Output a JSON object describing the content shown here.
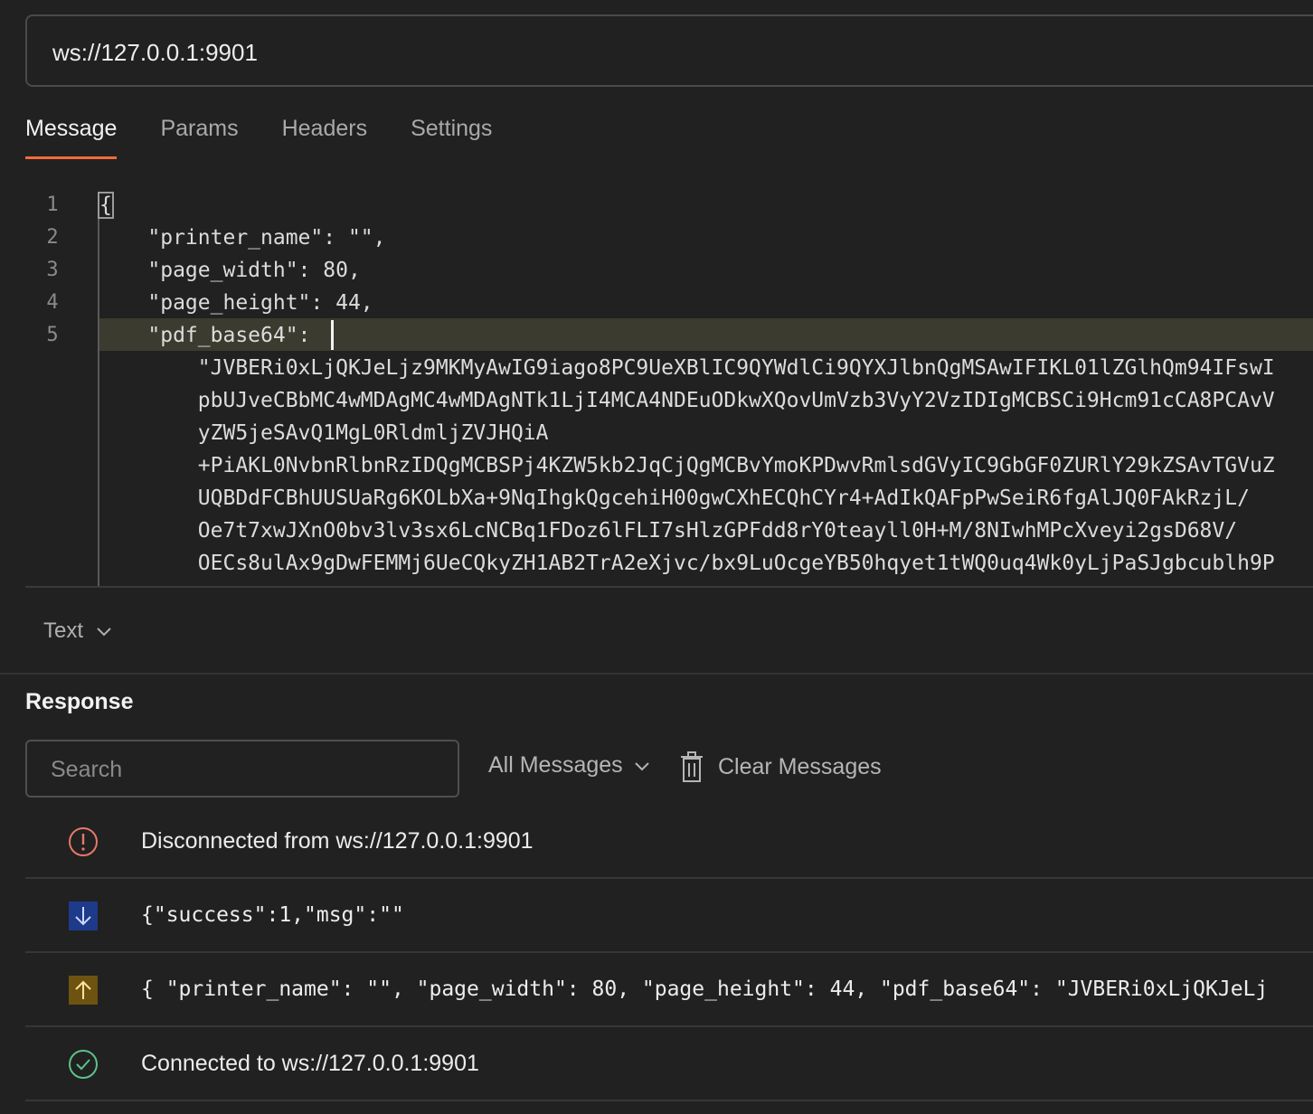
{
  "url": {
    "value": "ws://127.0.0.1:9901"
  },
  "tabs": [
    {
      "label": "Message",
      "active": true
    },
    {
      "label": "Params",
      "active": false
    },
    {
      "label": "Headers",
      "active": false
    },
    {
      "label": "Settings",
      "active": false
    }
  ],
  "editor": {
    "line_numbers": [
      "1",
      "2",
      "3",
      "4",
      "5"
    ],
    "lines": [
      "{",
      "    \"printer_name\": \"\",",
      "    \"page_width\": 80,",
      "    \"page_height\": 44,",
      "    \"pdf_base64\": ",
      "        \"JVBERi0xLjQKJeLjz9MKMyAwIG9iago8PC9UeXBlIC9QYWdlCi9QYXJlbnQgMSAwIFIKL01lZGlhQm94IFswI",
      "        pbUJveCBbMC4wMDAgMC4wMDAgNTk1LjI4MCA4NDEuODkwXQovUmVzb3VyY2VzIDIgMCBSCi9Hcm91cCA8PCAvV",
      "        yZW5jeSAvQ1MgL0RldmljZVJHQiA",
      "        +PiAKL0NvbnRlbnRzIDQgMCBSPj4KZW5kb2JqCjQgMCBvYmoKPDwvRmlsdGVyIC9GbGF0ZURlY29kZSAvTGVuZ",
      "        UQBDdFCBhUUSUaRg6KOLbXa+9NqIhgkQgcehiH00gwCXhECQhCYr4+AdIkQAFpPwSeiR6fgAlJQ0FAkRzjL/",
      "        Oe7t7xwJXnO0bv3lv3sx6LcNCBq1FDoz6lFLI7sHlzGPFdd8rY0teayll0H+M/8NIwhMPcXveyi2gsD68V/",
      "        OECs8ulAx9gDwFEMMj6UeCQkyZH1AB2TrA2eXjvc/bx9LuOcgeYB50hqyet1tWQ0uq4Wk0yLjPaSJgbcublh9P"
    ]
  },
  "format": {
    "label": "Text"
  },
  "response": {
    "title": "Response",
    "search_placeholder": "Search",
    "filter_label": "All Messages",
    "clear_label": "Clear Messages",
    "messages": [
      {
        "type": "disconnected",
        "text": "Disconnected from ws://127.0.0.1:9901",
        "icon": "alert-circle-icon",
        "color": "#e8786a"
      },
      {
        "type": "received",
        "text": "{\"success\":1,\"msg\":\"\"",
        "icon": "arrow-down-icon",
        "color": "#3c5bd6"
      },
      {
        "type": "sent",
        "text": "{ \"printer_name\": \"\", \"page_width\": 80, \"page_height\": 44, \"pdf_base64\": \"JVBERi0xLjQKJeLj",
        "icon": "arrow-up-icon",
        "color": "#c9a12a"
      },
      {
        "type": "connected",
        "text": "Connected to ws://127.0.0.1:9901",
        "icon": "check-circle-icon",
        "color": "#5cc28a"
      }
    ]
  },
  "colors": {
    "background": "#212121",
    "accent": "#f26b3a"
  }
}
